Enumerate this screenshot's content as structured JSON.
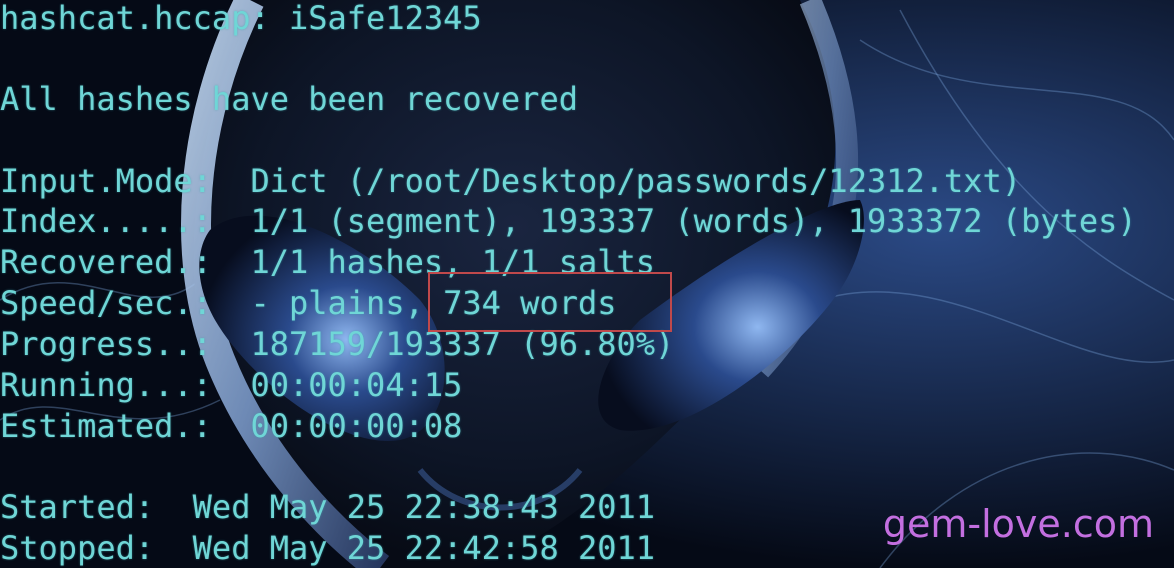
{
  "terminal": {
    "lines": [
      "hashcat.hccap: iSafe12345",
      "All hashes have been recovered",
      "Input.Mode:  Dict (/root/Desktop/passwords/12312.txt)",
      "Index.....:  1/1 (segment), 193337 (words), 1933372 (bytes)",
      "Recovered.:  1/1 hashes, 1/1 salts",
      "Speed/sec.:  - plains, 734 words",
      "Progress..:  187159/193337 (96.80%)",
      "Running...:  00:00:04:15",
      "Estimated.:  00:00:00:08",
      "Started:  Wed May 25 22:38:43 2011",
      "Stopped:  Wed May 25 22:42:58 2011"
    ],
    "highlighted_text": "734 words"
  },
  "watermark": "gem-love.com",
  "colors": {
    "terminal_text": "#6fd6d6",
    "highlight_border": "#c0494b",
    "watermark": "#c36fe0",
    "background": "#050a14"
  }
}
